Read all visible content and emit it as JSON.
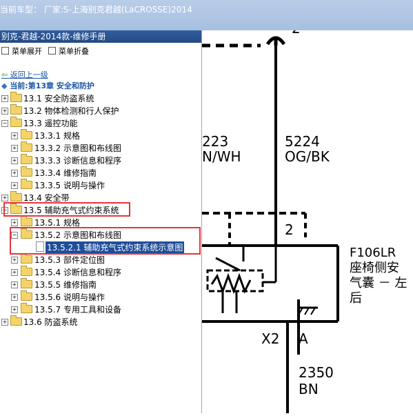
{
  "window": {
    "title": "当前车型： 厂家:S-上海别克君越(LaCROSSE)2014"
  },
  "panel": {
    "title": "别克-君越-2014款-维修手册",
    "toolbar": {
      "expand": "菜单展开",
      "collapse": "菜单折叠"
    },
    "back_link": "返回上一级",
    "chapter_label": "当前:第13章 安全和防护"
  },
  "tree": [
    {
      "label": "13.1 安全防盗系统"
    },
    {
      "label": "13.2 物体检测和行人保护"
    },
    {
      "label": "13.3 遥控功能"
    },
    {
      "label": "13.3.1 规格"
    },
    {
      "label": "13.3.2 示意图和布线图"
    },
    {
      "label": "13.3.3 诊断信息和程序"
    },
    {
      "label": "13.3.4 维修指南"
    },
    {
      "label": "13.3.5 说明与操作"
    },
    {
      "label": "13.4 安全带"
    },
    {
      "label": "13.5 辅助充气式约束系统"
    },
    {
      "label": "13.5.1 规格"
    },
    {
      "label": "13.5.2 示意图和布线图"
    },
    {
      "label": "13.5.2.1 辅助充气式约束系统示意图"
    },
    {
      "label": "13.5.3 部件定位图"
    },
    {
      "label": "13.5.4 诊断信息和程序"
    },
    {
      "label": "13.5.5 维修指南"
    },
    {
      "label": "13.5.6 说明与操作"
    },
    {
      "label": "13.5.7 专用工具和设备"
    },
    {
      "label": "13.6 防盗系统"
    }
  ],
  "diagram": {
    "pin_top": "2",
    "wire_left_num": "223",
    "wire_left_color": "N/WH",
    "wire_right_num": "5224",
    "wire_right_color": "OG/BK",
    "pin_mid": "2",
    "component_id": "F106LR",
    "component_line1": "座椅侧安",
    "component_line2": "气囊 － 左",
    "component_line3": "后",
    "connector": "X2",
    "terminal": "A",
    "wire_bottom_num": "2350",
    "wire_bottom_color": "BN"
  }
}
